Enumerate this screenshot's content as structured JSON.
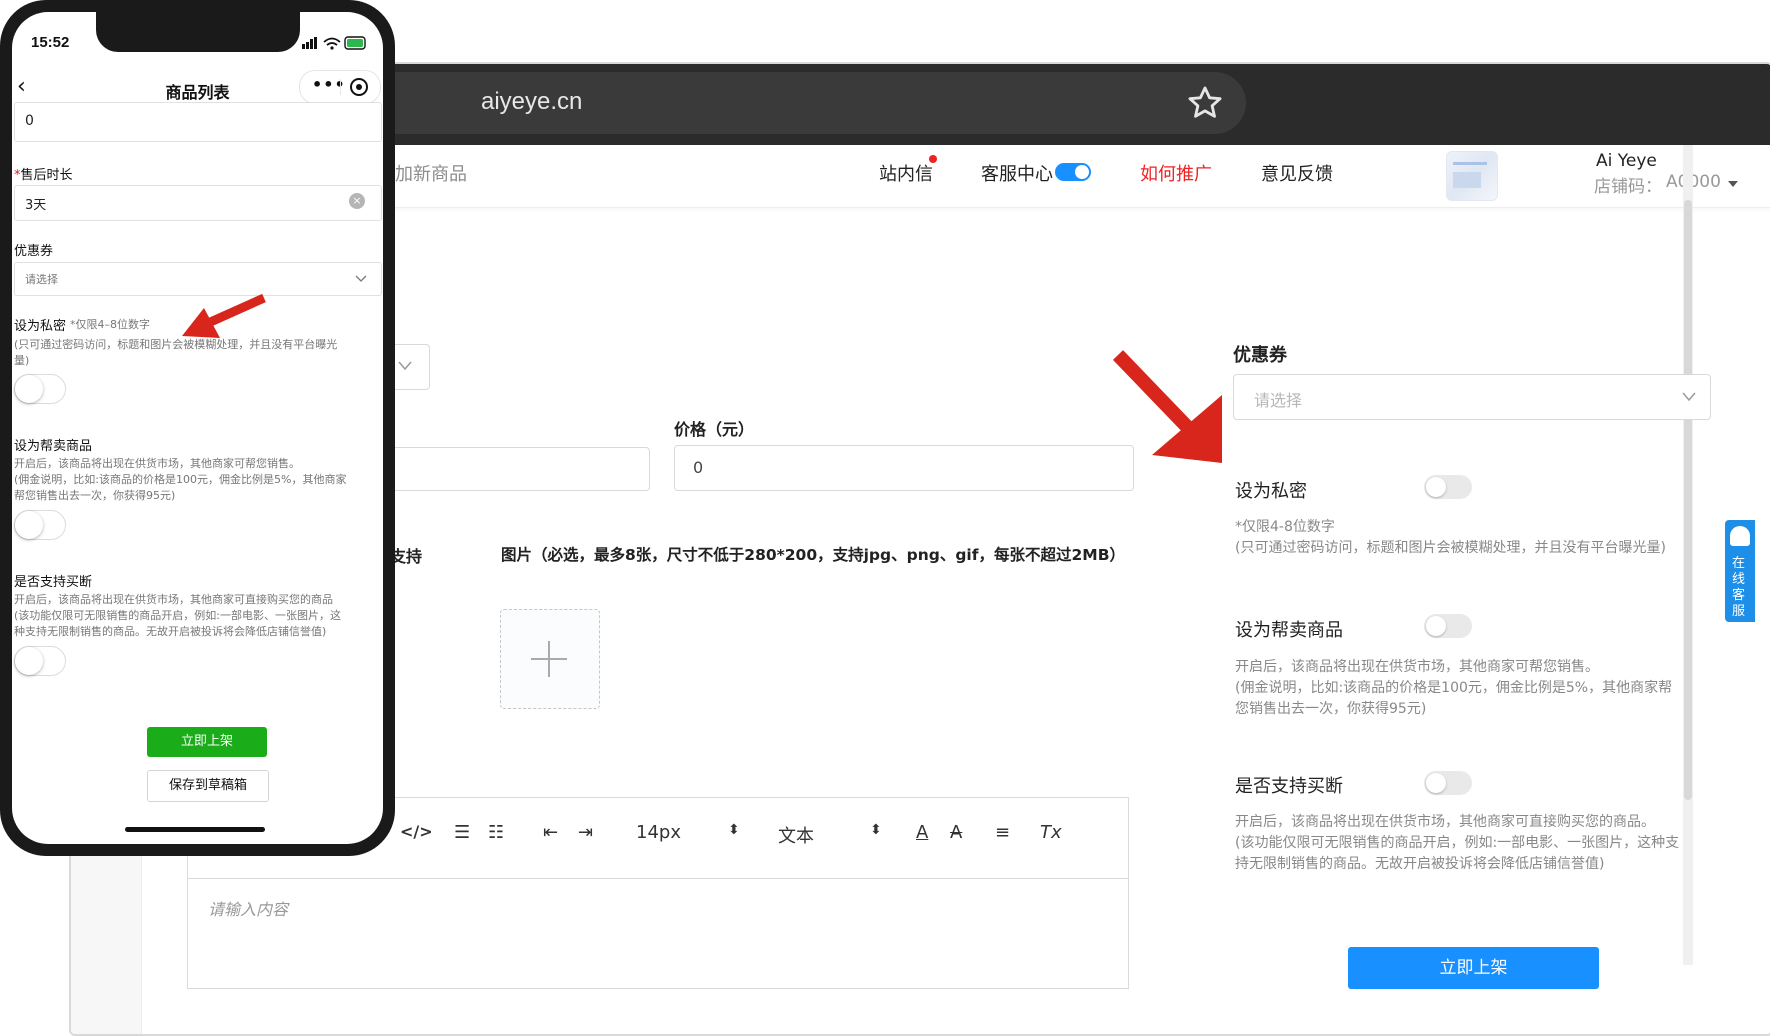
{
  "browser": {
    "url": "aiyeye.cn"
  },
  "topnav": {
    "back_label": "加新商品",
    "messages_label": "站内信",
    "service_center_label": "客服中心",
    "promote_label": "如何推广",
    "feedback_label": "意见反馈",
    "user_name": "Ai Yeye",
    "store_code_label": "店铺码：",
    "store_code": "A0000"
  },
  "form": {
    "price_label": "价格（元）",
    "price_value": "0",
    "support_fragment": "支持",
    "images_label": "图片（必选，最多8张，尺寸不低于280*200，支持jpg、png、gif，每张不超过2MB）"
  },
  "editor": {
    "font_size": "14px",
    "block_type": "文本",
    "placeholder": "请输入内容"
  },
  "right_panel": {
    "coupon_label": "优惠券",
    "coupon_placeholder": "请选择",
    "private_label": "设为私密",
    "private_note": "*仅限4-8位数字",
    "private_help": "(只可通过密码访问，标题和图片会被模糊处理，并且没有平台曝光量)",
    "resell_label": "设为帮卖商品",
    "resell_help_1": "开启后，该商品将出现在供货市场，其他商家可帮您销售。",
    "resell_help_2": "(佣金说明，比如:该商品的价格是100元，佣金比例是5%，其他商家帮",
    "resell_help_3": "您销售出去一次，你获得95元)",
    "buyout_label": "是否支持买断",
    "buyout_help_1": "开启后，该商品将出现在供货市场，其他商家可直接购买您的商品。",
    "buyout_help_2": "(该功能仅限可无限销售的商品开启，例如:一部电影、一张图片，这种支",
    "buyout_help_3": "持无限制销售的商品。无故开启被投诉将会降低店铺信誉值)",
    "publish_button": "立即上架",
    "online_service": "在线客服"
  },
  "phone": {
    "time": "15:52",
    "title": "商品列表",
    "top_input_value": "0",
    "after_sale_label": "售后时长",
    "after_sale_value": "3天",
    "coupon_label": "优惠券",
    "coupon_placeholder": "请选择",
    "private_label": "设为私密",
    "private_note": "*仅限4–8位数字",
    "private_help_1": "(只可通过密码访问，标题和图片会被模糊处理，并且没有平台曝光",
    "private_help_2": "量)",
    "resell_label": "设为帮卖商品",
    "resell_help_1": "开启后，该商品将出现在供货市场，其他商家可帮您销售。",
    "resell_help_2": "(佣金说明，比如:该商品的价格是100元，佣金比例是5%，其他商家",
    "resell_help_3": "帮您销售出去一次，你获得95元)",
    "buyout_label": "是否支持买断",
    "buyout_help_1": "开启后，该商品将出现在供货市场，其他商家可直接购买您的商品",
    "buyout_help_2": "(该功能仅限可无限销售的商品开启，例如:一部电影、一张图片，这",
    "buyout_help_3": "种支持无限制销售的商品。无故开启被投诉将会降低店铺信誉值)",
    "publish_button": "立即上架",
    "draft_button": "保存到草稿箱"
  },
  "colors": {
    "accent_blue": "#1890ff",
    "promote_red": "#ee2222",
    "wechat_green": "#1aad19",
    "annotation_red": "#d9261c"
  },
  "icons": [
    "star-icon",
    "plus-icon",
    "chevron-down-icon",
    "clear-icon",
    "back-icon",
    "more-icon",
    "record-icon",
    "bell-icon"
  ]
}
